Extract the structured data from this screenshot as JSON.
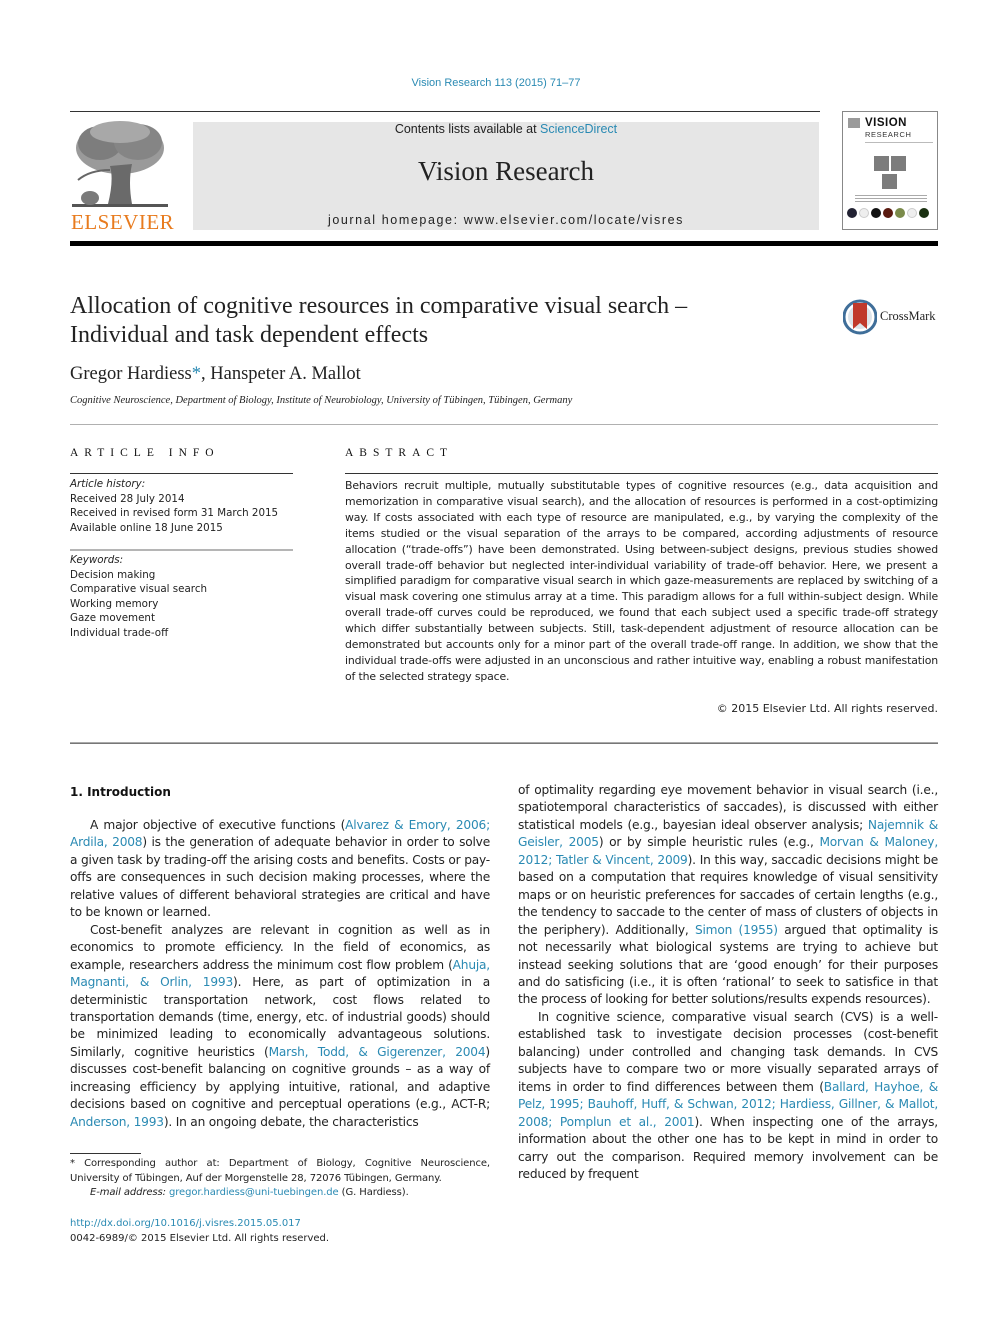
{
  "header": {
    "citation": "Vision Research 113 (2015) 71–77",
    "contents_prefix": "Contents lists available at ",
    "contents_link": "ScienceDirect",
    "journal_name": "Vision Research",
    "homepage": "journal homepage: www.elsevier.com/locate/visres",
    "publisher": "ELSEVIER",
    "cover_title": "VISION",
    "cover_subtitle": "RESEARCH",
    "crossmark_label": "CrossMark"
  },
  "article": {
    "title": "Allocation of cognitive resources in comparative visual search – Individual and task dependent effects",
    "authors": [
      {
        "name": "Gregor Hardiess",
        "mark": "*"
      },
      {
        "name": "Hanspeter A. Mallot",
        "mark": ""
      }
    ],
    "author_separator": ", ",
    "affiliation": "Cognitive Neuroscience, Department of Biology, Institute of Neurobiology, University of Tübingen, Tübingen, Germany"
  },
  "article_info": {
    "heading": "ARTICLE INFO",
    "history_label": "Article history:",
    "history": [
      "Received 28 July 2014",
      "Received in revised form 31 March 2015",
      "Available online 18 June 2015"
    ],
    "keywords_label": "Keywords:",
    "keywords": [
      "Decision making",
      "Comparative visual search",
      "Working memory",
      "Gaze movement",
      "Individual trade-off"
    ]
  },
  "abstract": {
    "heading": "ABSTRACT",
    "text": "Behaviors recruit multiple, mutually substitutable types of cognitive resources (e.g., data acquisition and memorization in comparative visual search), and the allocation of resources is performed in a cost-optimizing way. If costs associated with each type of resource are manipulated, e.g., by varying the complexity of the items studied or the visual separation of the arrays to be compared, according adjustments of resource allocation (“trade-offs”) have been demonstrated. Using between-subject designs, previous studies showed overall trade-off behavior but neglected inter-individual variability of trade-off behavior. Here, we present a simplified paradigm for comparative visual search in which gaze-measurements are replaced by switching of a visual mask covering one stimulus array at a time. This paradigm allows for a full within-subject design. While overall trade-off curves could be reproduced, we found that each subject used a specific trade-off strategy which differ substantially between subjects. Still, task-dependent adjustment of resource allocation can be demonstrated but accounts only for a minor part of the overall trade-off range. In addition, we show that the individual trade-offs were adjusted in an unconscious and rather intuitive way, enabling a robust manifestation of the selected strategy space.",
    "copyright": "© 2015 Elsevier Ltd. All rights reserved."
  },
  "body": {
    "section_heading": "1. Introduction",
    "left_column": [
      {
        "indent": true,
        "segments": [
          {
            "t": "A major objective of executive functions ("
          },
          {
            "t": "Alvarez & Emory, 2006; Ardila, 2008",
            "link": true
          },
          {
            "t": ") is the generation of adequate behavior in order to solve a given task by trading-off the arising costs and benefits. Costs or pay-offs are consequences in such decision making processes, where the relative values of different behavioral strategies are critical and have to be known or learned."
          }
        ]
      },
      {
        "indent": true,
        "segments": [
          {
            "t": "Cost-benefit analyzes are relevant in cognition as well as in economics to promote efficiency. In the field of economics, as example, researchers address the minimum cost flow problem ("
          },
          {
            "t": "Ahuja, Magnanti, & Orlin, 1993",
            "link": true
          },
          {
            "t": "). Here, as part of optimization in a deterministic transportation network, cost flows related to transportation demands (time, energy, etc. of industrial goods) should be minimized leading to economically advantageous solutions. Similarly, cognitive heuristics ("
          },
          {
            "t": "Marsh, Todd, & Gigerenzer, 2004",
            "link": true
          },
          {
            "t": ") discusses cost-benefit balancing on cognitive grounds – as a way of increasing efficiency by applying intuitive, rational, and adaptive decisions based on cognitive and perceptual operations (e.g., ACT-R; "
          },
          {
            "t": "Anderson, 1993",
            "link": true
          },
          {
            "t": "). In an ongoing debate, the characteristics"
          }
        ]
      }
    ],
    "right_column": [
      {
        "indent": false,
        "segments": [
          {
            "t": "of optimality regarding eye movement behavior in visual search (i.e., spatiotemporal characteristics of saccades), is discussed with either statistical models (e.g., bayesian ideal observer analysis; "
          },
          {
            "t": "Najemnik & Geisler, 2005",
            "link": true
          },
          {
            "t": ") or by simple heuristic rules (e.g., "
          },
          {
            "t": "Morvan & Maloney, 2012; Tatler & Vincent, 2009",
            "link": true
          },
          {
            "t": "). In this way, saccadic decisions might be based on a computation that requires knowledge of visual sensitivity maps or on heuristic preferences for saccades of certain lengths (e.g., the tendency to saccade to the center of mass of clusters of objects in the periphery). Additionally, "
          },
          {
            "t": "Simon (1955)",
            "link": true
          },
          {
            "t": " argued that optimality is not necessarily what biological systems are trying to achieve but instead seeking solutions that are ‘good enough’ for their purposes and do satisficing (i.e., it is often ‘rational’ to seek to satisfice in that the process of looking for better solutions/results expends resources)."
          }
        ]
      },
      {
        "indent": true,
        "segments": [
          {
            "t": "In cognitive science, comparative visual search (CVS) is a well-established task to investigate decision processes (cost-benefit balancing) under controlled and changing task demands. In CVS subjects have to compare two or more visually separated arrays of items in order to find differences between them ("
          },
          {
            "t": "Ballard, Hayhoe, & Pelz, 1995; Bauhoff, Huff, & Schwan, 2012; Hardiess, Gillner, & Mallot, 2008; Pomplun et al., 2001",
            "link": true
          },
          {
            "t": "). When inspecting one of the arrays, information about the other one has to be kept in mind in order to carry out the comparison. Required memory involvement can be reduced by frequent"
          }
        ]
      }
    ]
  },
  "footnote": {
    "corresponding": "* Corresponding author at: Department of Biology, Cognitive Neuroscience, University of Tübingen, Auf der Morgenstelle 28, 72076 Tübingen, Germany.",
    "email_label": "E-mail address: ",
    "email": "gregor.hardiess@uni-tuebingen.de",
    "email_suffix": " (G. Hardiess).",
    "doi": "http://dx.doi.org/10.1016/j.visres.2015.05.017",
    "issn": "0042-6989/© 2015 Elsevier Ltd. All rights reserved."
  },
  "colors": {
    "link": "#2a8ab3",
    "elsevier_orange": "#e87b1e",
    "masthead_bg": "#e6e6e6",
    "crossmark_red": "#c0392b",
    "crossmark_blue": "#3f6e99"
  }
}
